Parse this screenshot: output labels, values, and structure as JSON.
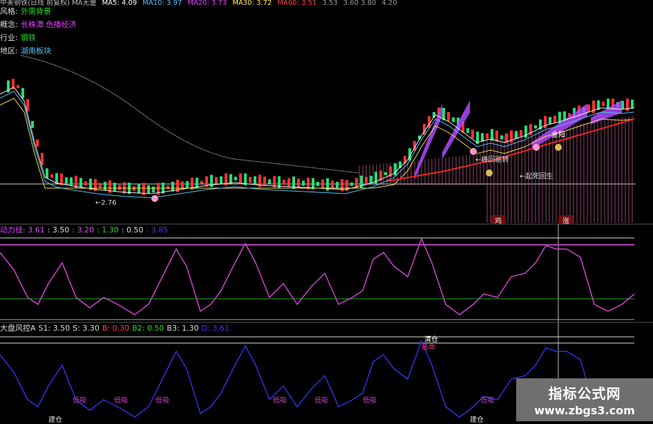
{
  "ma_bar": {
    "items": [
      {
        "text": "中美钢铁(日线 前复权) MA无量",
        "color": "#bbbbbb"
      },
      {
        "text": "MA5: 4.09",
        "color": "#ffffff"
      },
      {
        "text": "MA10: 3.97",
        "color": "#4fc3f7"
      },
      {
        "text": "MA20: 3.73",
        "color": "#e040fb"
      },
      {
        "text": "MA30: 3.72",
        "color": "#ffee58"
      },
      {
        "text": "MA60: 3.51",
        "color": "#ff4040"
      },
      {
        "text": "3.53",
        "color": "#999999"
      },
      {
        "text": "3.60 3.80",
        "color": "#999999"
      },
      {
        "text": "4.20",
        "color": "#999999"
      }
    ]
  },
  "info_panel": [
    {
      "key": "风格:",
      "value": "外需背景",
      "color": "#22dd22"
    },
    {
      "key": "概念:",
      "value": "长株潭 色播经济",
      "color": "#e040fb"
    },
    {
      "key": "行业:",
      "value": "钢铁",
      "color": "#22dd22"
    },
    {
      "key": "地区:",
      "value": "湖南板块",
      "color": "#4fc3f7"
    }
  ],
  "annotations": {
    "low_price": "←2.76",
    "wind_turn": "←峰回路转",
    "revival": "←起死回生",
    "jingu": "金阳",
    "marker_a": "鸡",
    "marker_b": "涨"
  },
  "indicator1": {
    "name": "动力线",
    "items": [
      {
        "text": "动力线: 3.61",
        "color": "#e040fb"
      },
      {
        "text": ": 3.50",
        "color": "#dddddd"
      },
      {
        "text": ": 3.20",
        "color": "#e040fb"
      },
      {
        "text": ": 1.30",
        "color": "#22dd22"
      },
      {
        "text": ": 0.50",
        "color": "#dddddd"
      },
      {
        "text": ": 3.85",
        "color": "#3a3aff"
      }
    ]
  },
  "indicator2": {
    "items": [
      {
        "text": "大盘风控A",
        "color": "#dddddd"
      },
      {
        "text": "S1: 3.50",
        "color": "#dddddd"
      },
      {
        "text": "S: 3.30",
        "color": "#dddddd"
      },
      {
        "text": "B: 0.30",
        "color": "#ff4040"
      },
      {
        "text": "B2: 0.50",
        "color": "#22dd22"
      },
      {
        "text": "B3: 1.30",
        "color": "#dddddd"
      },
      {
        "text": "D: 3.61",
        "color": "#3a3aff"
      }
    ],
    "clear_label": "清仓",
    "escape_label": "逃命",
    "add_labels": [
      "低吸",
      "低吸",
      "低吸",
      "低吸",
      "低吸",
      "低吸",
      "低吸"
    ],
    "bottom_labels": [
      "建仓",
      "建仓"
    ]
  },
  "watermark": {
    "title": "指标公式网",
    "url": "www.zbgs3.com"
  },
  "colors": {
    "up_candle": "#ff3030",
    "down_candle": "#22dd77",
    "kingstrip": "#b048ff",
    "oscillator": "#cc44cc",
    "risk_line": "#3030dd",
    "ref_white": "#dddddd",
    "ref_purple": "#b040b0",
    "ref_green": "#22aa22"
  }
}
